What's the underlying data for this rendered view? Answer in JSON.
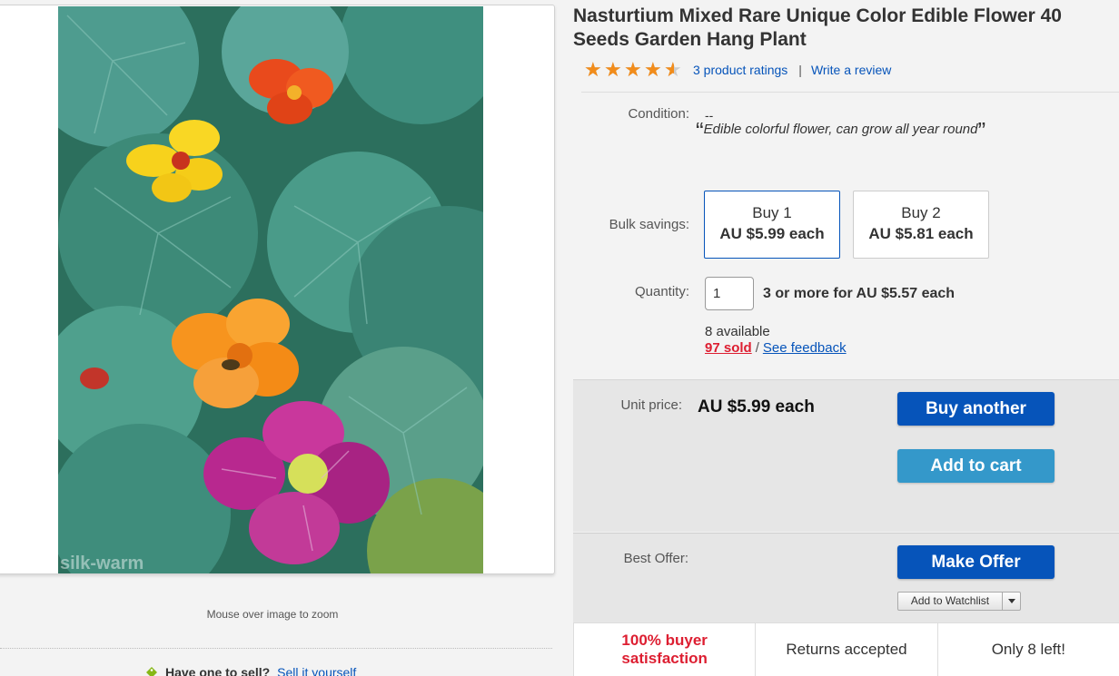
{
  "product": {
    "title": "Nasturtium Mixed Rare Unique Color Edible Flower 40 Seeds Garden Hang Plant",
    "rating_value": 4.5,
    "ratings_link": "3 product ratings",
    "write_review": "Write a review"
  },
  "image": {
    "watermark": "silk-warm",
    "zoom_hint": "Mouse over image to zoom"
  },
  "sell": {
    "prompt": "Have one to sell?",
    "link": "Sell it yourself"
  },
  "condition": {
    "label": "Condition:",
    "value": "--",
    "note": "Edible colorful flower, can grow all year round",
    "open_quote": "“",
    "close_quote": "”"
  },
  "bulk": {
    "label": "Bulk savings:",
    "options": [
      {
        "qty": "Buy 1",
        "price": "AU $5.99 each",
        "selected": true
      },
      {
        "qty": "Buy 2",
        "price": "AU $5.81 each",
        "selected": false
      }
    ]
  },
  "quantity": {
    "label": "Quantity:",
    "value": "1",
    "discount": "3 or more for AU $5.57 each",
    "available": "8 available",
    "sold": "97 sold",
    "separator": "/",
    "feedback": "See feedback"
  },
  "pricing": {
    "label": "Unit price:",
    "value": "AU $5.99 each",
    "buy_button": "Buy another",
    "cart_button": "Add to cart"
  },
  "offer": {
    "label": "Best Offer:",
    "button": "Make Offer",
    "watchlist": "Add to Watchlist"
  },
  "badges": {
    "satisfaction_line1": "100% buyer",
    "satisfaction_line2": "satisfaction",
    "returns": "Returns accepted",
    "stock": "Only 8 left!"
  },
  "colors": {
    "link": "#0654ba",
    "star": "#f18c1b",
    "primary_button": "#0654ba",
    "secondary_button": "#3498ca",
    "alert_red": "#dd1e31"
  }
}
